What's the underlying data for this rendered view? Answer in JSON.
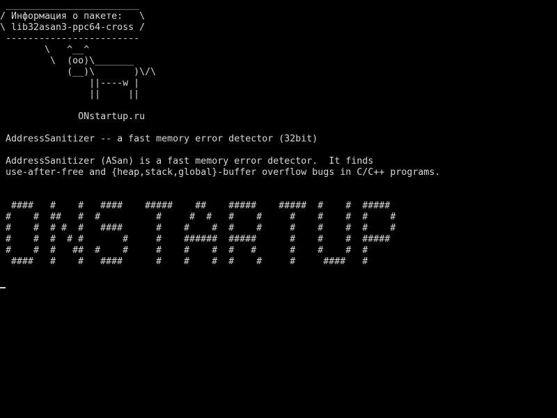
{
  "banner": {
    "lines": [
      " ________________________",
      "/ Информация о пакете:   \\",
      "\\ lib32asan3-ppc64-cross /",
      " ------------------------",
      "        \\   ^__^",
      "         \\  (oo)\\_______",
      "            (__)\\       )\\/\\",
      "                ||----w |",
      "                ||     ||"
    ]
  },
  "site": "              ONstartup.ru",
  "summary": " AddressSanitizer -- a fast memory error detector (32bit)",
  "description": [
    " AddressSanitizer (ASan) is a fast memory error detector.  It finds",
    " use-after-free and {heap,stack,global}-buffer overflow bugs in C/C++ programs."
  ],
  "figlet": {
    "lines": [
      "  ####   #    #   ####    #####    ##    #####    #####  #    #  #####",
      " #    #  ##   #  #          #     #  #   #    #     #    #    #  #    #",
      " #    #  # #  #   ####      #    #    #  #    #     #    #    #  #    #",
      " #    #  #  # #       #     #    ######  #####      #    #    #  #####",
      " #    #  #   ##  #    #     #    #    #  #   #      #    #    #  #",
      "  ####   #    #   ####      #    #    #  #    #     #     ####   #"
    ]
  },
  "colors": {
    "background": "#000000",
    "foreground": "#d8d8d8"
  },
  "icons": {
    "cursor": "underscore-cursor"
  }
}
